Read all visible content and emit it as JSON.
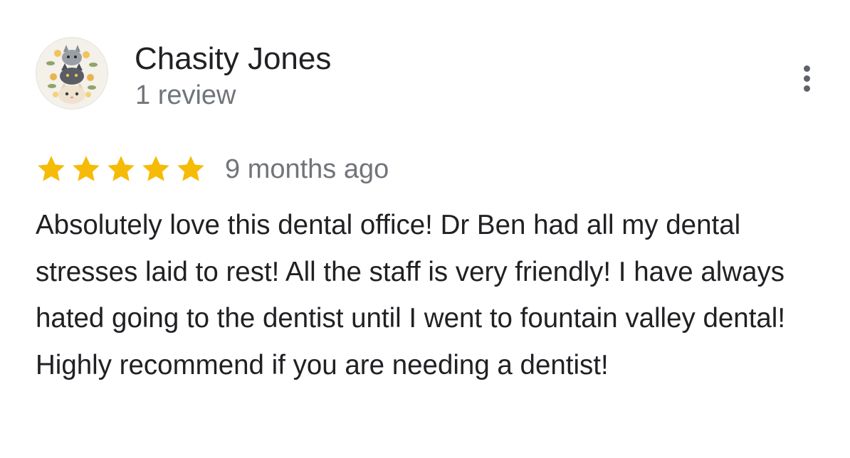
{
  "review": {
    "author": {
      "name": "Chasity Jones",
      "review_count": "1 review",
      "avatar_icon": "cat-stack-avatar-icon"
    },
    "menu_icon": "more-vert-icon",
    "rating": {
      "value": 5,
      "max": 5,
      "star_color": "#f6bb06"
    },
    "timestamp": "9 months ago",
    "text": "Absolutely love this dental office! Dr Ben had all my dental stresses laid to rest! All the staff is very friendly! I have always hated going to the dentist until I went to fountain valley dental! Highly recommend if you are needing a dentist!"
  }
}
